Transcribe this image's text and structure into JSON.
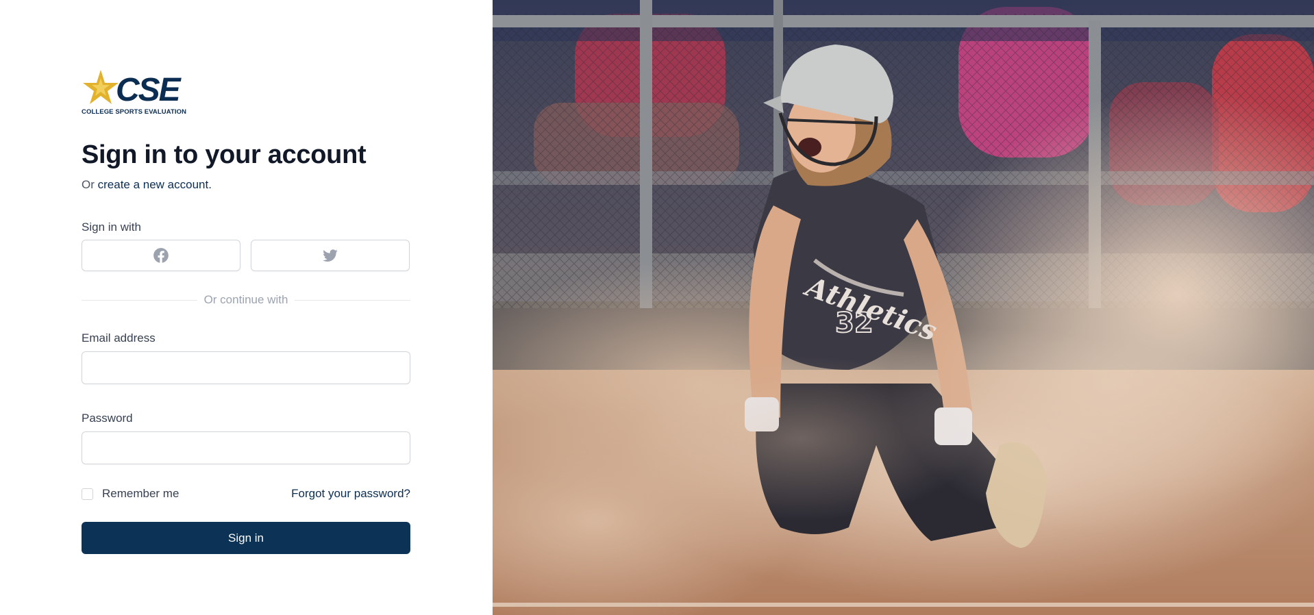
{
  "brand": {
    "logo_text": "CSE",
    "logo_tagline": "COLLEGE SPORTS EVALUATION",
    "logo_icon": "gold-star-icon",
    "colors": {
      "navy": "#0c2d52",
      "gold": "#e2b22c"
    }
  },
  "heading": {
    "title": "Sign in to your account",
    "subtitle_prefix": "Or",
    "subtitle_link": "create a new account."
  },
  "social": {
    "label": "Sign in with",
    "buttons": [
      {
        "icon": "facebook-icon"
      },
      {
        "icon": "twitter-icon"
      }
    ]
  },
  "divider": {
    "text": "Or continue with"
  },
  "form": {
    "email_label": "Email address",
    "email_value": "",
    "password_label": "Password",
    "password_value": "",
    "remember_label": "Remember me",
    "remember_checked": false,
    "forgot_label": "Forgot your password?",
    "submit_label": "Sign in"
  },
  "hero": {
    "subject": "softball player kneeling at home plate in a cloud of dust",
    "jersey_text": "Athletics",
    "jersey_number": "32"
  },
  "theme": {
    "primary": "#0c3356",
    "border": "#d1d5db",
    "muted": "#9ca3af"
  }
}
